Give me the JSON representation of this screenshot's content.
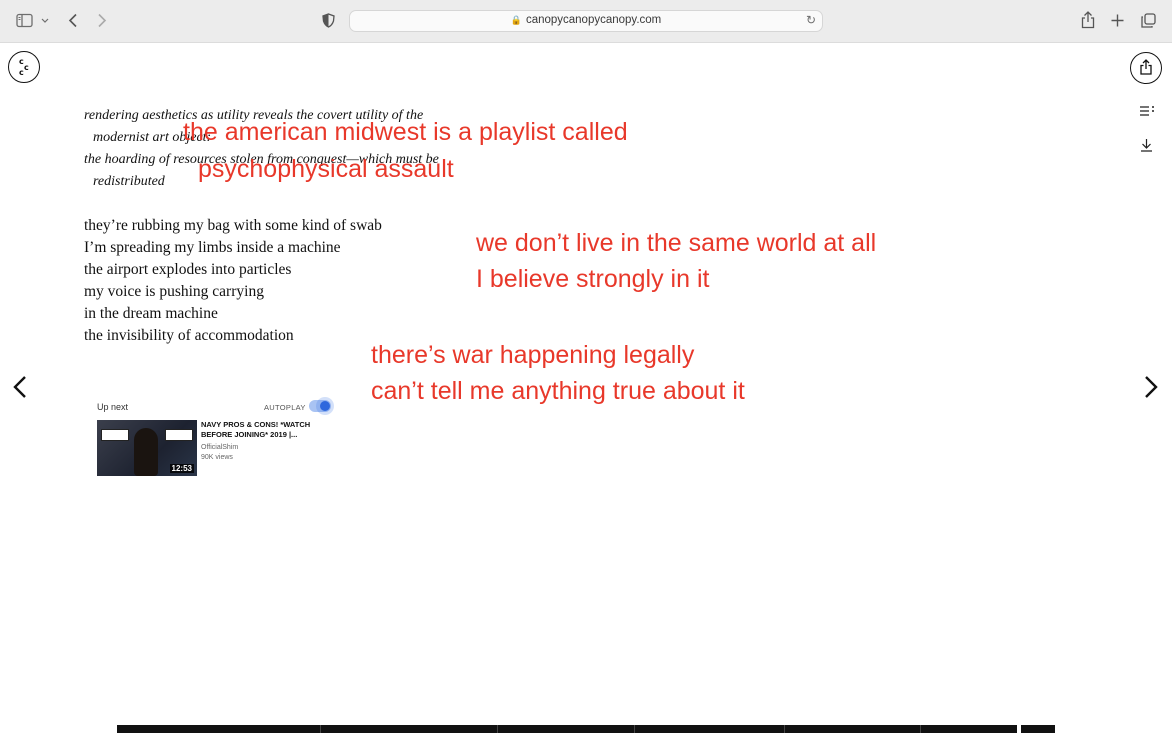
{
  "browser": {
    "url": "canopycanopycanopy.com",
    "icons": [
      "sidebar-icon",
      "chevron-down-icon",
      "back-icon",
      "forward-icon",
      "shield-icon",
      "lock-icon",
      "reload-icon",
      "share-icon",
      "new-tab-icon",
      "tabs-icon"
    ]
  },
  "site": {
    "logo_letters": [
      "c",
      "c",
      "c"
    ],
    "controls": [
      "share-icon",
      "list-icon",
      "download-icon"
    ]
  },
  "poem": {
    "italic_lines": [
      "rendering aesthetics as utility reveals the covert utility of the",
      "modernist art object:",
      "the hoarding of resources stolen from conquest—which must be",
      "redistributed"
    ],
    "stanza_lines": [
      "they’re rubbing my bag with some kind of swab",
      "I’m spreading my limbs inside a machine",
      "the airport explodes into particles",
      "my voice is pushing carrying",
      "in the dream machine",
      "the invisibility of accommodation"
    ]
  },
  "annotations": {
    "a1": [
      "the american midwest is a playlist called",
      "psychophysical assault"
    ],
    "a2": [
      "we don’t live in the same world at all",
      "I believe strongly in it"
    ],
    "a3": [
      "there’s war happening legally",
      "can’t tell me anything true about it"
    ],
    "color": "#e8382a"
  },
  "upnext": {
    "label": "Up next",
    "autoplay_label": "AUTOPLAY",
    "autoplay_on": true,
    "video": {
      "title": "NAVY PROS & CONS! *WATCH BEFORE JOINING* 2019 |...",
      "channel": "OfficialShim",
      "views": "90K views",
      "duration": "12:53"
    }
  },
  "nav": {
    "prev": "‹",
    "next": "›"
  }
}
